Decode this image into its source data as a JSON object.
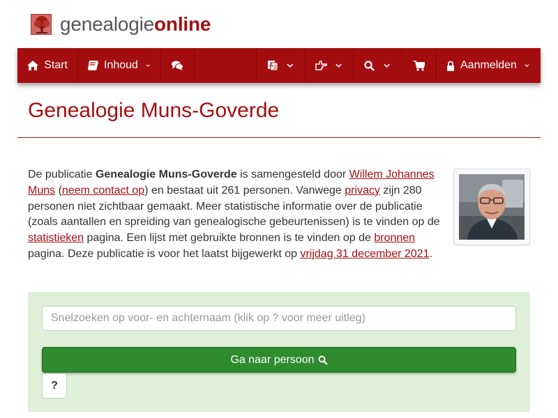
{
  "header": {
    "logo_part1": "genealogie",
    "logo_part2": "online"
  },
  "nav": {
    "start_label": "Start",
    "inhoud_label": "Inhoud",
    "login_label": "Aanmelden",
    "icons": [
      "home-icon",
      "book-icon",
      "comments-icon",
      "language-icon",
      "hand-pointer-icon",
      "search-icon",
      "cart-icon",
      "lock-icon"
    ]
  },
  "page": {
    "title": "Genealogie Muns-Goverde"
  },
  "intro": {
    "t1": "De publicatie ",
    "pub_name": "Genealogie Muns-Goverde",
    "t2": " is samengesteld door ",
    "author_link": "Willem Johannes Muns",
    "t3": " (",
    "contact_link": "neem contact op",
    "t4": ") en bestaat uit 261 personen. Vanwege ",
    "privacy_link": "privacy",
    "t5": " zijn 280 personen niet zichtbaar gemaakt. Meer statistische informatie over de publicatie (zoals aantallen en spreiding van genealogische gebeurtenissen) is te vinden op de ",
    "stats_link": "statistieken",
    "t6": " pagina. Een lijst met gebruikte bronnen is te vinden op de ",
    "sources_link": "bronnen",
    "t7": " pagina. Deze publicatie is voor het laatst bijgewerkt op ",
    "date_link": "vrijdag 31 december 2021",
    "t8": "."
  },
  "search": {
    "placeholder": "Snelzoeken op voor- en achternaam (klik op ? voor meer uitleg)",
    "value": "",
    "go_label": "Ga naar persoon",
    "help_label": "?"
  },
  "colors": {
    "brand": "#a50e10",
    "panel": "#dff0d8",
    "button_green": "#2e8b2e"
  }
}
